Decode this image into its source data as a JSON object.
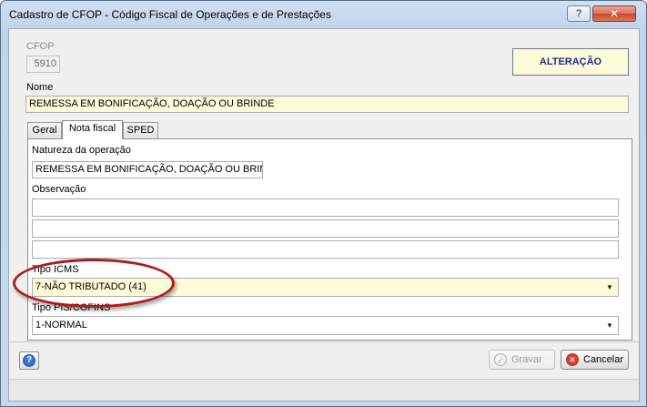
{
  "window": {
    "title": "Cadastro de CFOP - Código Fiscal de Operações e de Prestações",
    "help_glyph": "?",
    "close_glyph": "✕"
  },
  "header": {
    "cfop_label": "CFOP",
    "cfop_value": "5910",
    "mode": "ALTERAÇÃO",
    "nome_label": "Nome",
    "nome_value": "REMESSA EM BONIFICAÇÃO, DOAÇÃO OU BRINDE"
  },
  "tabs": [
    {
      "label": "Geral",
      "active": false
    },
    {
      "label": "Nota fiscal",
      "active": true
    },
    {
      "label": "SPED",
      "active": false
    }
  ],
  "nota_fiscal": {
    "natureza_label": "Natureza da operação",
    "natureza_value": "REMESSA EM BONIFICAÇÃO, DOAÇÃO OU BRINDE",
    "observacao_label": "Observação",
    "observacao_lines": [
      "",
      "",
      ""
    ],
    "tipo_icms_label": "Tipo ICMS",
    "tipo_icms_value": "7-NÃO TRIBUTADO (41)",
    "tipo_pis_label": "Tipo PIS/COFINS",
    "tipo_pis_value": "1-NORMAL"
  },
  "footer": {
    "help_glyph": "?",
    "save_label": "Gravar",
    "cancel_label": "Cancelar"
  },
  "colors": {
    "highlight_field": "#fefbd8",
    "mode_text": "#1a2f8a",
    "annotation_ring": "#b01b1b"
  }
}
